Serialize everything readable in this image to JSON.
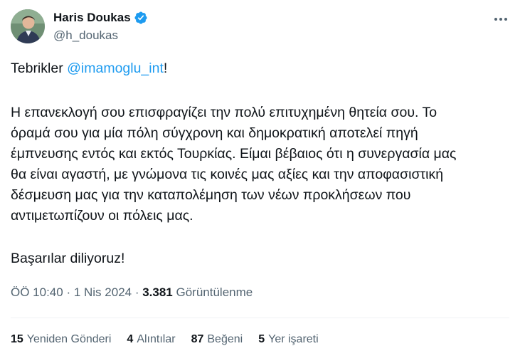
{
  "author": {
    "display_name": "Haris Doukas",
    "handle": "@h_doukas",
    "verified_icon": "verified-badge-icon",
    "avatar": "profile-photo"
  },
  "menu_icon": "more-options-icon",
  "tweet": {
    "greeting_prefix": "Tebrikler ",
    "mention": "@imamoglu_int",
    "greeting_suffix": "!",
    "lines": [
      "Η επανεκλογή σου επισφραγίζει την πολύ επιτυχημένη θητεία σου. Το",
      "όραμά σου για μία πόλη σύγχρονη και δημοκρατική αποτελεί πηγή",
      "έμπνευσης εντός και εκτός Τουρκίας. Είμαι βέβαιος ότι η συνεργασία μας",
      "θα είναι αγαστή, με γνώμονα τις κοινές μας αξίες και την αποφασιστική",
      "δέσμευση μας για την καταπολέμηση των νέων προκλήσεων που",
      "αντιμετωπίζουν οι πόλεις μας."
    ],
    "closing": "Başarılar diliyoruz!"
  },
  "meta": {
    "time": "ÖÖ 10:40",
    "sep1": " · ",
    "date": "1 Nis 2024",
    "sep2": " · ",
    "views_count": "3.381",
    "views_label": " Görüntülenme"
  },
  "stats": {
    "reposts_count": "15",
    "reposts_label": "Yeniden Gönderi",
    "quotes_count": "4",
    "quotes_label": "Alıntılar",
    "likes_count": "87",
    "likes_label": "Beğeni",
    "bookmarks_count": "5",
    "bookmarks_label": "Yer işareti"
  },
  "colors": {
    "accent": "#1d9bf0",
    "text": "#0f1419",
    "secondary": "#536471"
  }
}
